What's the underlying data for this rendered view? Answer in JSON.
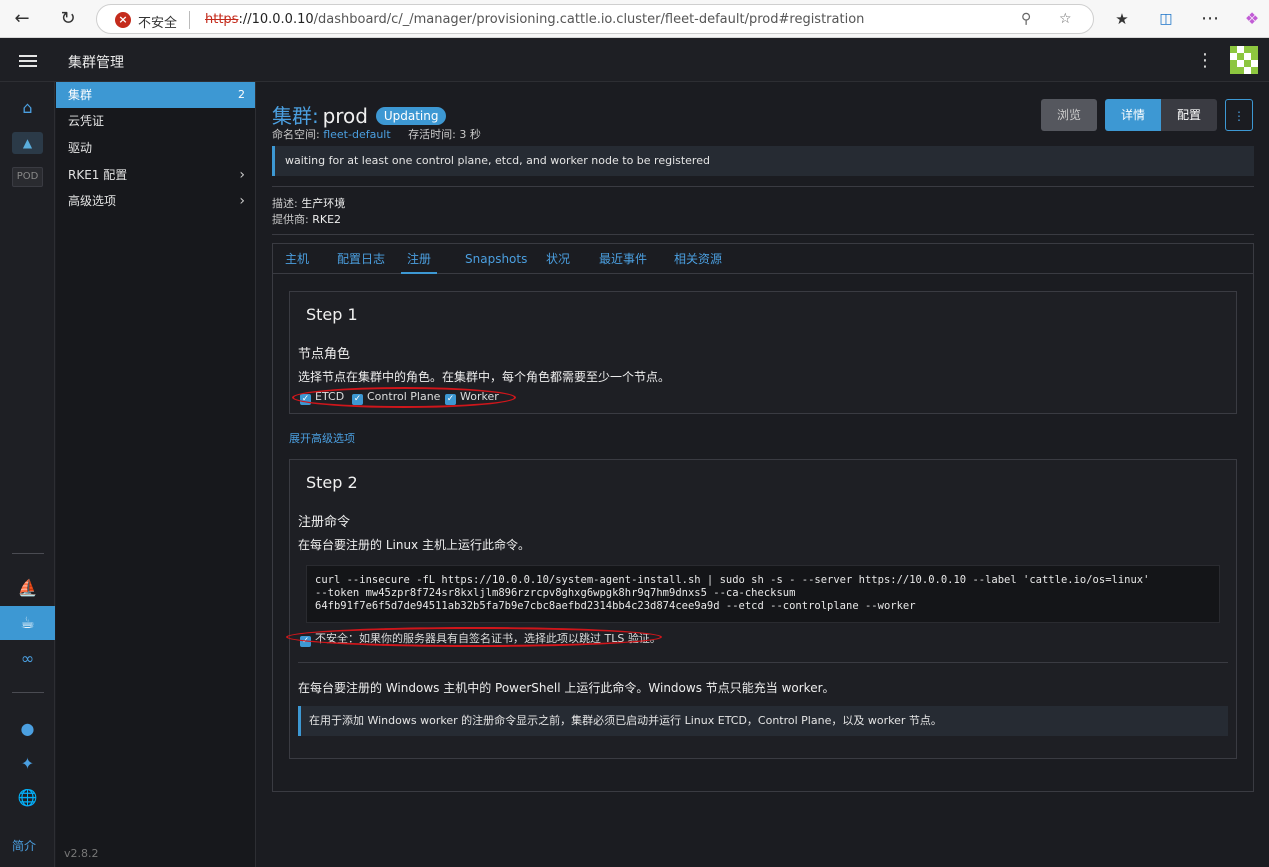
{
  "browser": {
    "insecure_label": "不安全",
    "url_proto": "https",
    "url_host": "://10.0.0.10",
    "url_path": "/dashboard/c/_/manager/provisioning.cattle.io.cluster/fleet-default/prod#registration"
  },
  "header": {
    "title": "集群管理"
  },
  "rail": {
    "pod_label": "POD",
    "brief_label": "简介"
  },
  "sidebar": {
    "items": [
      {
        "label": "集群",
        "count": "2"
      },
      {
        "label": "云凭证"
      },
      {
        "label": "驱动"
      },
      {
        "label": "RKE1 配置"
      },
      {
        "label": "高级选项"
      }
    ],
    "version": "v2.8.2"
  },
  "cluster": {
    "kind_label": "集群:",
    "name": "prod",
    "state": "Updating",
    "namespace_label": "命名空间:",
    "namespace": "fleet-default",
    "age_label": "存活时间:",
    "age": "3 秒",
    "banner": "waiting for at least one control plane, etcd, and worker node to be registered",
    "description_label": "描述:",
    "description": "生产环境",
    "provider_label": "提供商:",
    "provider": "RKE2"
  },
  "buttons": {
    "browse": "浏览",
    "detail": "详情",
    "config": "配置"
  },
  "tabs": [
    "主机",
    "配置日志",
    "注册",
    "Snapshots",
    "状况",
    "最近事件",
    "相关资源"
  ],
  "step1": {
    "title": "Step 1",
    "heading": "节点角色",
    "subtitle": "选择节点在集群中的角色。在集群中，每个角色都需要至少一个节点。",
    "roles": [
      "ETCD",
      "Control Plane",
      "Worker"
    ],
    "advanced_link": "展开高级选项"
  },
  "step2": {
    "title": "Step 2",
    "heading": "注册命令",
    "linux_subtitle": "在每台要注册的 Linux 主机上运行此命令。",
    "command": "curl --insecure -fL https://10.0.0.10/system-agent-install.sh | sudo sh -s - --server https://10.0.0.10 --label 'cattle.io/os=linux'\n--token mw45zpr8f724sr8kxljlm896rzrcpv8ghxg6wpgk8hr9q7hm9dnxs5 --ca-checksum\n64fb91f7e6f5d7de94511ab32b5fa7b9e7cbc8aefbd2314bb4c23d874cee9a9d --etcd --controlplane --worker",
    "insecure_label": "不安全：如果你的服务器具有自签名证书，选择此项以跳过 TLS 验证。",
    "windows_subtitle": "在每台要注册的 Windows 主机中的 PowerShell 上运行此命令。Windows 节点只能充当 worker。",
    "windows_info": "在用于添加 Windows worker 的注册命令显示之前，集群必须已启动并运行 Linux ETCD，Control Plane，以及 worker 节点。"
  },
  "colors": {
    "accent": "#3d98d3",
    "highlight": "#d0161b"
  }
}
